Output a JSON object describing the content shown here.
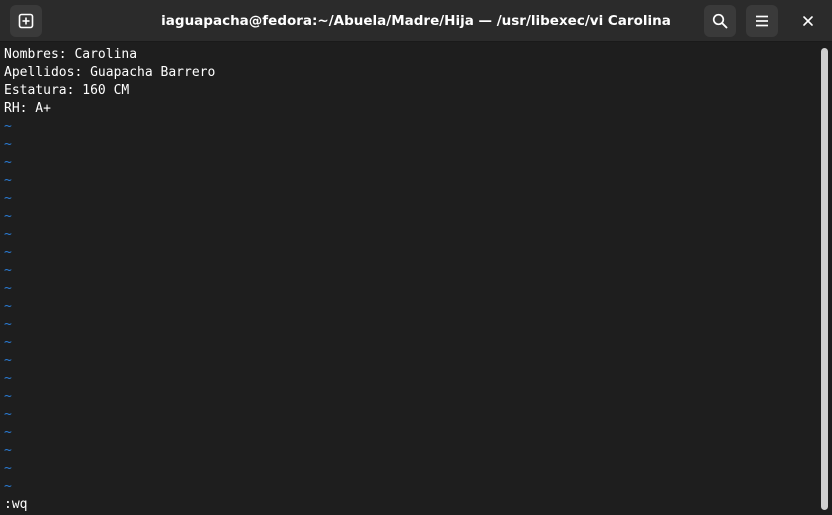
{
  "window": {
    "title": "iaguapacha@fedora:~/Abuela/Madre/Hija — /usr/libexec/vi Carolina"
  },
  "icons": {
    "new_tab": "new-tab-icon",
    "search": "search-icon",
    "menu": "hamburger-menu-icon",
    "close": "close-icon"
  },
  "editor": {
    "lines": [
      "Nombres: Carolina",
      "Apellidos: Guapacha Barrero",
      "Estatura: 160 CM",
      "RH: A+"
    ],
    "empty_marker": "~",
    "empty_line_count": 21,
    "command": ":wq"
  },
  "colors": {
    "background": "#1e1e1e",
    "headerbar": "#2b2b2b",
    "text": "#ffffff",
    "tilde": "#2a7bd4"
  }
}
